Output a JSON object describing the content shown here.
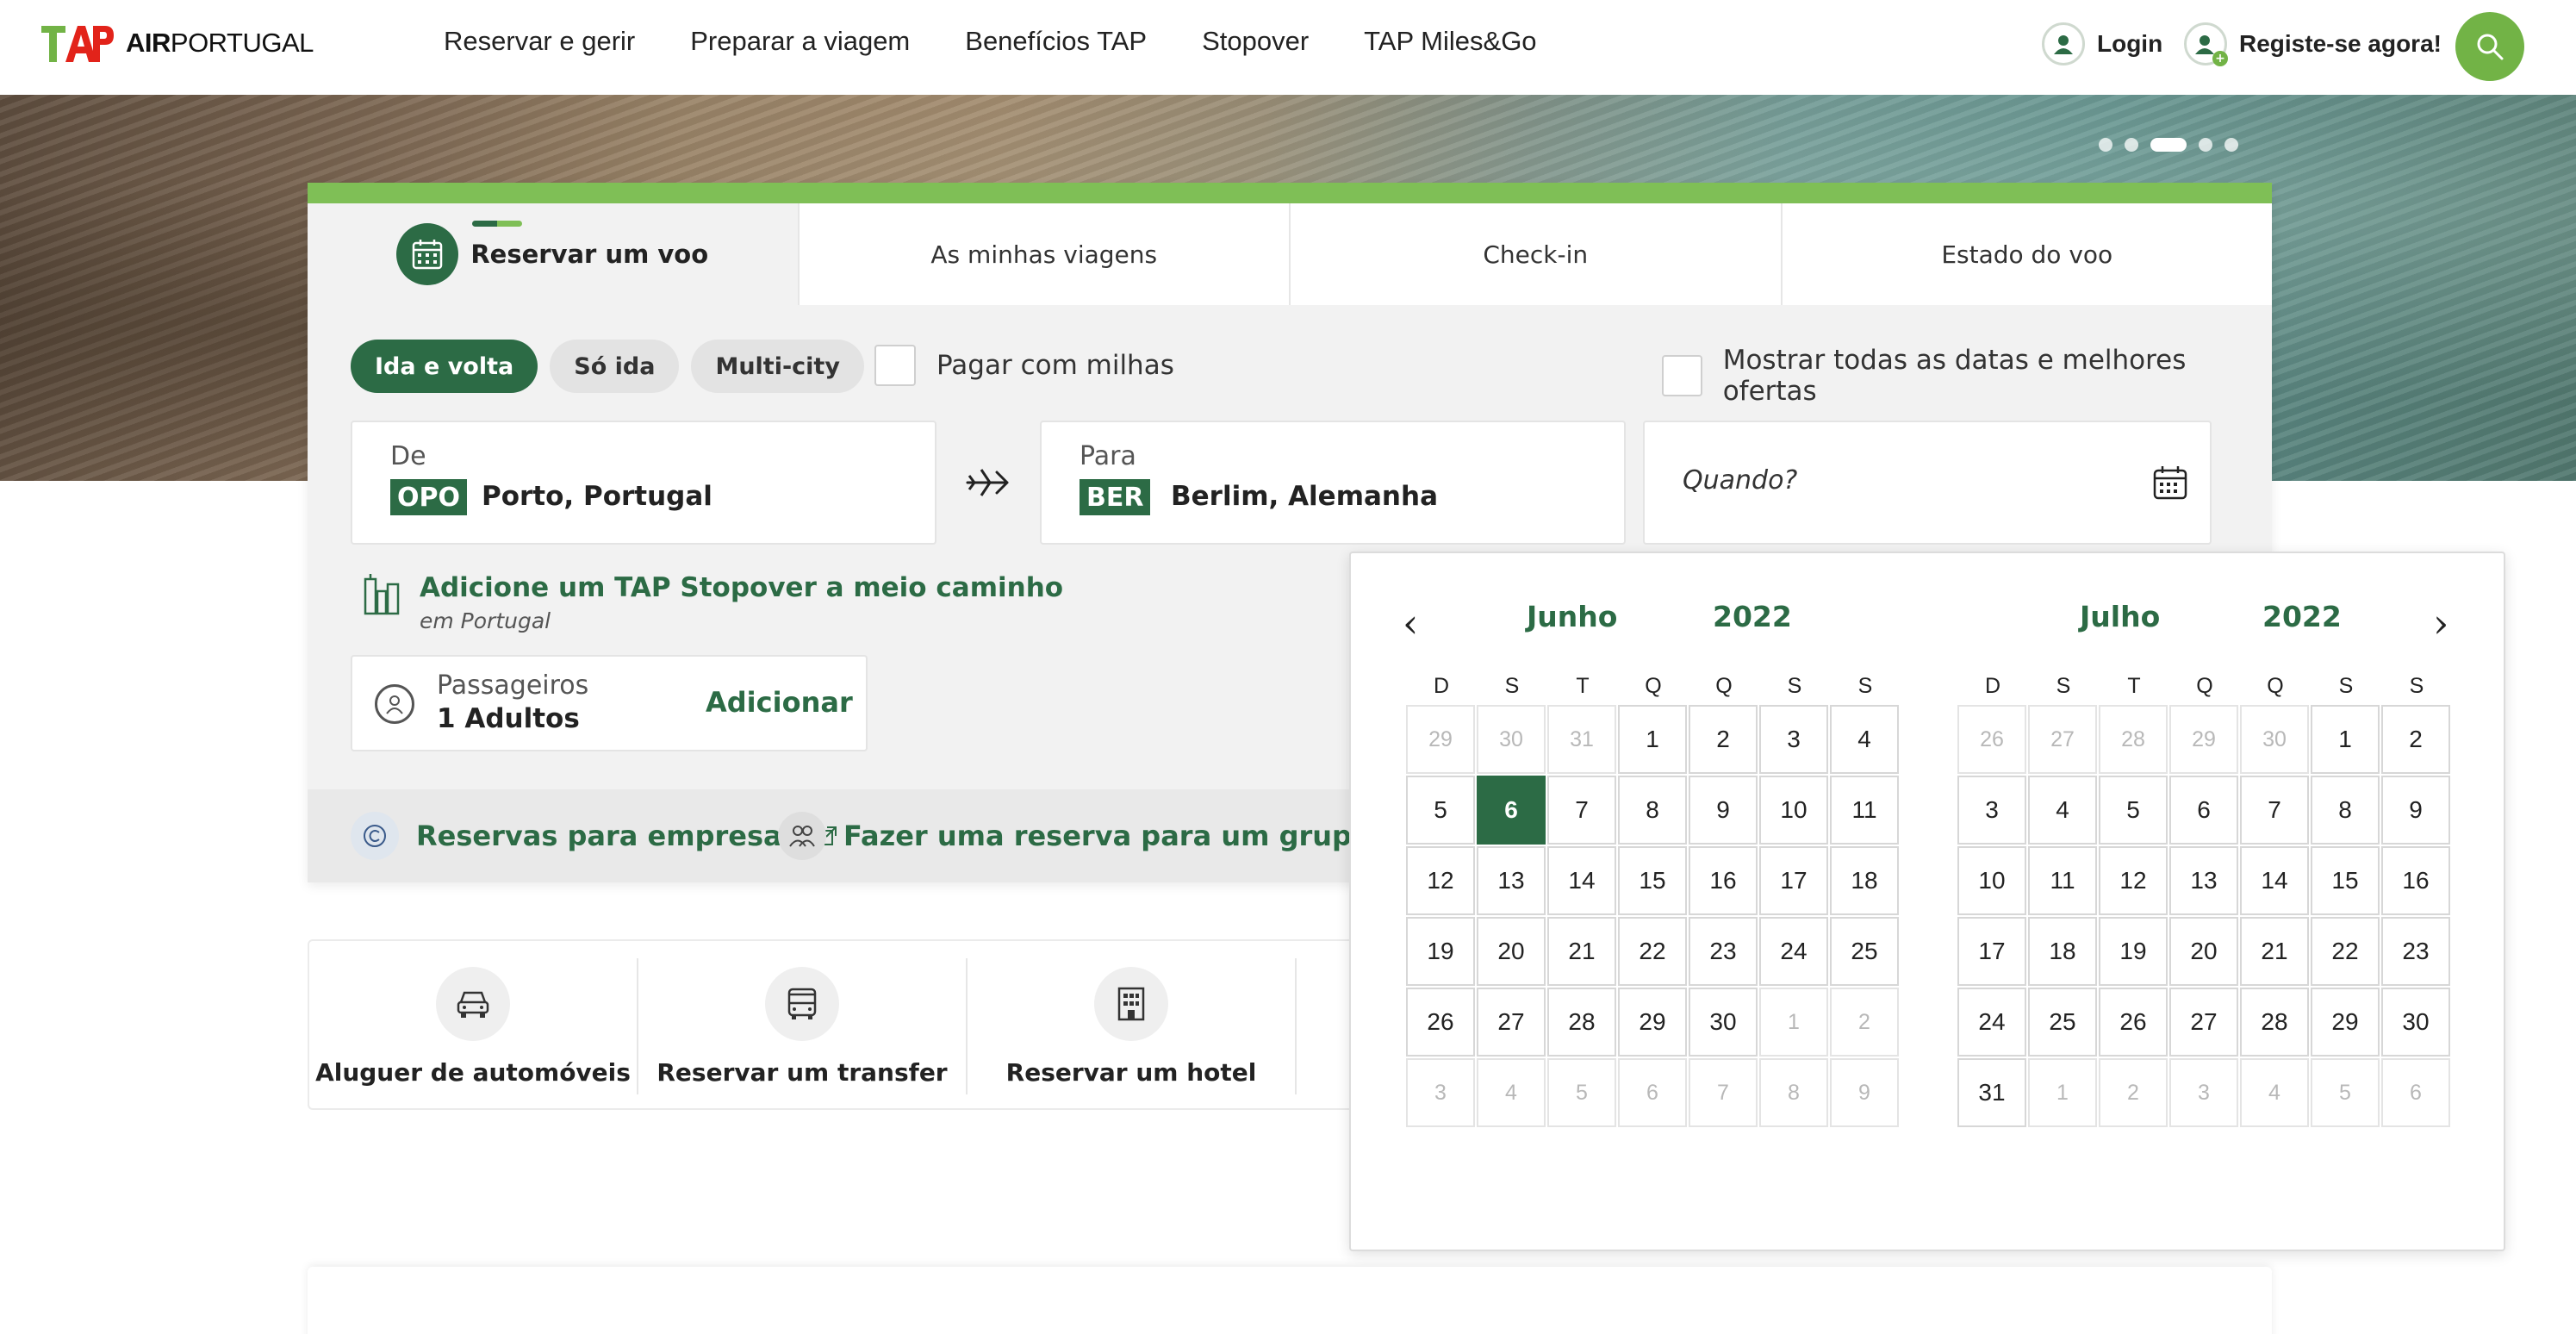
{
  "brand": {
    "logo_text_bold": "AIR",
    "logo_text_light": "PORTUGAL",
    "colors": {
      "green_dark": "#2c6b45",
      "green_light": "#72b346",
      "red": "#e2231a"
    }
  },
  "nav": {
    "items": [
      "Reservar e gerir",
      "Preparar a viagem",
      "Benefícios TAP",
      "Stopover",
      "TAP Miles&Go"
    ]
  },
  "header": {
    "login": "Login",
    "register": "Registe-se agora!",
    "search_icon": "search-icon"
  },
  "hero": {
    "slides": 5,
    "active_slide": 3
  },
  "booking": {
    "tabs": [
      "Reservar um voo",
      "As minhas viagens",
      "Check-in",
      "Estado do voo"
    ],
    "trip_types": [
      "Ida e volta",
      "Só ida",
      "Multi-city"
    ],
    "pay_with_miles": "Pagar com milhas",
    "show_all_dates": "Mostrar todas as datas e melhores ofertas",
    "from": {
      "label": "De",
      "code": "OPO",
      "city": "Porto, Portugal"
    },
    "to": {
      "label": "Para",
      "code": "BER",
      "city": "Berlim, Alemanha"
    },
    "when": {
      "placeholder": "Quando?"
    },
    "stopover": {
      "title": "Adicione um TAP Stopover a meio caminho",
      "subtitle": "em Portugal"
    },
    "passengers": {
      "label": "Passageiros",
      "value": "1 Adultos",
      "add": "Adicionar"
    },
    "footer": {
      "business": "Reservas para empresas",
      "group": "Fazer uma reserva para um grupo (mais de"
    }
  },
  "services": [
    "Aluguer de automóveis",
    "Reservar um transfer",
    "Reservar um hotel"
  ],
  "calendar": {
    "prev": "‹",
    "next": "›",
    "weekdays": [
      "D",
      "S",
      "T",
      "Q",
      "Q",
      "S",
      "S"
    ],
    "months": [
      {
        "month": "Junho",
        "year": "2022",
        "weeks": [
          [
            "29",
            "30",
            "31",
            "1",
            "2",
            "3",
            "4"
          ],
          [
            "5",
            "6",
            "7",
            "8",
            "9",
            "10",
            "11"
          ],
          [
            "12",
            "13",
            "14",
            "15",
            "16",
            "17",
            "18"
          ],
          [
            "19",
            "20",
            "21",
            "22",
            "23",
            "24",
            "25"
          ],
          [
            "26",
            "27",
            "28",
            "29",
            "30",
            "1",
            "2"
          ],
          [
            "3",
            "4",
            "5",
            "6",
            "7",
            "8",
            "9"
          ]
        ],
        "other_month": [
          [
            0,
            0
          ],
          [
            0,
            1
          ],
          [
            0,
            2
          ],
          [
            4,
            5
          ],
          [
            4,
            6
          ],
          [
            5,
            0
          ],
          [
            5,
            1
          ],
          [
            5,
            2
          ],
          [
            5,
            3
          ],
          [
            5,
            4
          ],
          [
            5,
            5
          ],
          [
            5,
            6
          ]
        ],
        "selected": [
          1,
          1
        ]
      },
      {
        "month": "Julho",
        "year": "2022",
        "weeks": [
          [
            "26",
            "27",
            "28",
            "29",
            "30",
            "1",
            "2"
          ],
          [
            "3",
            "4",
            "5",
            "6",
            "7",
            "8",
            "9"
          ],
          [
            "10",
            "11",
            "12",
            "13",
            "14",
            "15",
            "16"
          ],
          [
            "17",
            "18",
            "19",
            "20",
            "21",
            "22",
            "23"
          ],
          [
            "24",
            "25",
            "26",
            "27",
            "28",
            "29",
            "30"
          ],
          [
            "31",
            "1",
            "2",
            "3",
            "4",
            "5",
            "6"
          ]
        ],
        "other_month": [
          [
            0,
            0
          ],
          [
            0,
            1
          ],
          [
            0,
            2
          ],
          [
            0,
            3
          ],
          [
            0,
            4
          ],
          [
            5,
            1
          ],
          [
            5,
            2
          ],
          [
            5,
            3
          ],
          [
            5,
            4
          ],
          [
            5,
            5
          ],
          [
            5,
            6
          ]
        ],
        "selected": null
      }
    ]
  }
}
